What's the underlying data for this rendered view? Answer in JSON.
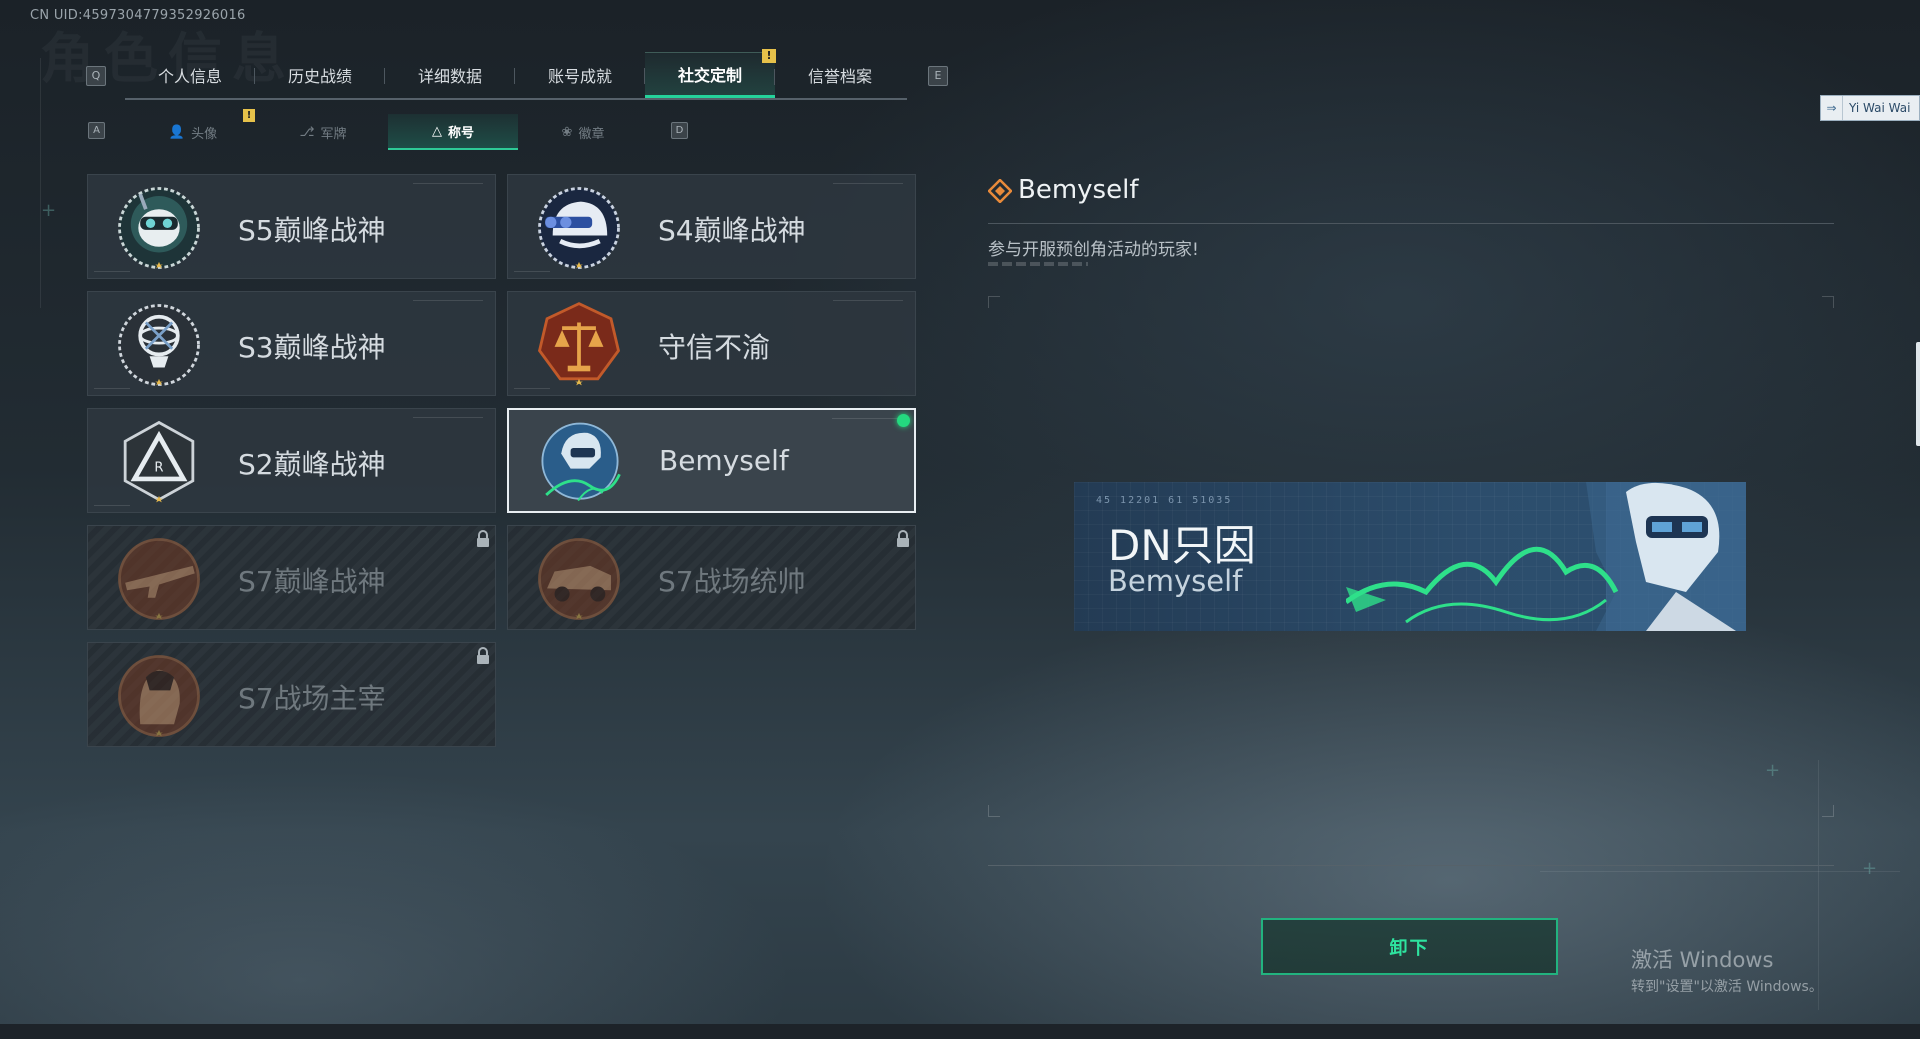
{
  "uid": "CN UID:4597304779352926016",
  "bg_title": "角色信息",
  "top_tabs": {
    "prev_key": "Q",
    "next_key": "E",
    "items": [
      {
        "label": "个人信息",
        "active": false
      },
      {
        "label": "历史战绩",
        "active": false
      },
      {
        "label": "详细数据",
        "active": false
      },
      {
        "label": "账号成就",
        "active": false
      },
      {
        "label": "社交定制",
        "active": true,
        "alert": "!"
      },
      {
        "label": "信誉档案",
        "active": false
      }
    ]
  },
  "sub_tabs": {
    "prev_key": "A",
    "next_key": "D",
    "items": [
      {
        "label": "头像",
        "icon": "person-icon",
        "alert": "!"
      },
      {
        "label": "军牌",
        "icon": "dogtag-icon"
      },
      {
        "label": "称号",
        "icon": "title-icon",
        "active": true
      },
      {
        "label": "徽章",
        "icon": "emblem-icon"
      }
    ]
  },
  "titles": [
    {
      "name": "S5巅峰战神",
      "locked": false,
      "badge": "diver-skull-badge"
    },
    {
      "name": "S4巅峰战神",
      "locked": false,
      "badge": "helmet-nightvision-badge"
    },
    {
      "name": "S3巅峰战神",
      "locked": false,
      "badge": "globe-trophy-badge"
    },
    {
      "name": "守信不渝",
      "locked": false,
      "badge": "scales-badge"
    },
    {
      "name": "S2巅峰战神",
      "locked": false,
      "badge": "triangle-emblem-badge"
    },
    {
      "name": "Bemyself",
      "locked": false,
      "selected": true,
      "equipped": true,
      "badge": "soldier-signature-badge"
    },
    {
      "name": "S7巅峰战神",
      "locked": true,
      "badge": "rifle-badge"
    },
    {
      "name": "S7战场统帅",
      "locked": true,
      "badge": "vehicle-badge"
    },
    {
      "name": "S7战场主宰",
      "locked": true,
      "badge": "operator-portrait-badge"
    }
  ],
  "detail": {
    "title": "Bemyself",
    "description": "参与开服预创角活动的玩家!"
  },
  "plate": {
    "player_name": "DN只因",
    "title": "Bemyself",
    "code": "45 12201   61 51035"
  },
  "unequip_label": "卸下",
  "friend_chip": {
    "label": "Yi Wai Wai",
    "icon": "friends-icon"
  },
  "windows_activation": {
    "line1": "激活 Windows",
    "line2": "转到\"设置\"以激活 Windows。"
  },
  "colors": {
    "accent_green": "#25d39b",
    "alert_yellow": "#e6c14a",
    "equipped_dot": "#24d97f",
    "plate_blue": "#2c4d6c"
  }
}
